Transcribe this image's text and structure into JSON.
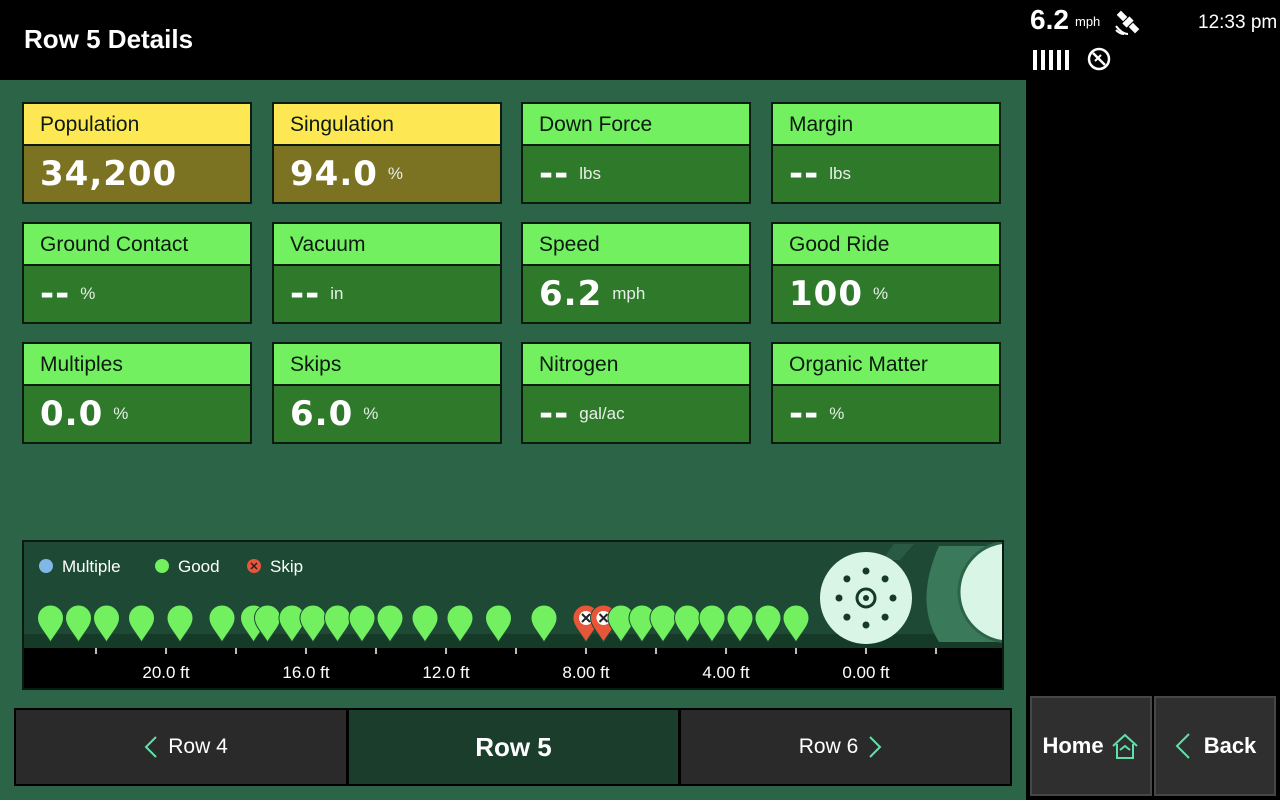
{
  "header": {
    "title": "Row 5 Details",
    "speed": "6.2",
    "speed_unit": "mph",
    "time": "12:33 pm"
  },
  "metrics": [
    {
      "label": "Population",
      "value": "34,200",
      "unit": "",
      "status": "yellow"
    },
    {
      "label": "Singulation",
      "value": "94.0",
      "unit": "%",
      "status": "yellow"
    },
    {
      "label": "Down Force",
      "value": "--",
      "unit": "lbs",
      "status": "green"
    },
    {
      "label": "Margin",
      "value": "--",
      "unit": "lbs",
      "status": "green"
    },
    {
      "label": "Ground Contact",
      "value": "--",
      "unit": "%",
      "status": "green"
    },
    {
      "label": "Vacuum",
      "value": "--",
      "unit": "in",
      "status": "green"
    },
    {
      "label": "Speed",
      "value": "6.2",
      "unit": "mph",
      "status": "green"
    },
    {
      "label": "Good Ride",
      "value": "100",
      "unit": "%",
      "status": "green"
    },
    {
      "label": "Multiples",
      "value": "0.0",
      "unit": "%",
      "status": "green"
    },
    {
      "label": "Skips",
      "value": "6.0",
      "unit": "%",
      "status": "green"
    },
    {
      "label": "Nitrogen",
      "value": "--",
      "unit": "gal/ac",
      "status": "green"
    },
    {
      "label": "Organic Matter",
      "value": "--",
      "unit": "%",
      "status": "green"
    }
  ],
  "seed_chart": {
    "legend": [
      {
        "label": "Multiple",
        "color": "#7fb8e6"
      },
      {
        "label": "Good",
        "color": "#72f060"
      },
      {
        "label": "Skip",
        "color": "#e8563a"
      }
    ],
    "ticks": [
      "20.0 ft",
      "16.0 ft",
      "12.0 ft",
      "8.00 ft",
      "4.00 ft",
      "0.00 ft"
    ],
    "tick_values_ft": [
      20,
      16,
      12,
      8,
      4,
      0
    ],
    "seeds_ft": [
      {
        "d": 23.3,
        "type": "good"
      },
      {
        "d": 22.5,
        "type": "good"
      },
      {
        "d": 21.7,
        "type": "good"
      },
      {
        "d": 20.7,
        "type": "good"
      },
      {
        "d": 19.6,
        "type": "good"
      },
      {
        "d": 18.4,
        "type": "good"
      },
      {
        "d": 17.5,
        "type": "good"
      },
      {
        "d": 17.1,
        "type": "good"
      },
      {
        "d": 16.4,
        "type": "good"
      },
      {
        "d": 15.8,
        "type": "good"
      },
      {
        "d": 15.1,
        "type": "good"
      },
      {
        "d": 14.4,
        "type": "good"
      },
      {
        "d": 13.6,
        "type": "good"
      },
      {
        "d": 12.6,
        "type": "good"
      },
      {
        "d": 11.6,
        "type": "good"
      },
      {
        "d": 10.5,
        "type": "good"
      },
      {
        "d": 9.2,
        "type": "good"
      },
      {
        "d": 8.0,
        "type": "skip"
      },
      {
        "d": 7.5,
        "type": "skip"
      },
      {
        "d": 7.0,
        "type": "good"
      },
      {
        "d": 6.4,
        "type": "good"
      },
      {
        "d": 5.8,
        "type": "good"
      },
      {
        "d": 5.1,
        "type": "good"
      },
      {
        "d": 4.4,
        "type": "good"
      },
      {
        "d": 3.6,
        "type": "good"
      },
      {
        "d": 2.8,
        "type": "good"
      },
      {
        "d": 2.0,
        "type": "good"
      }
    ]
  },
  "row_nav": {
    "prev": "Row 4",
    "current": "Row 5",
    "next": "Row 6"
  },
  "side_buttons": {
    "home": "Home",
    "back": "Back"
  }
}
